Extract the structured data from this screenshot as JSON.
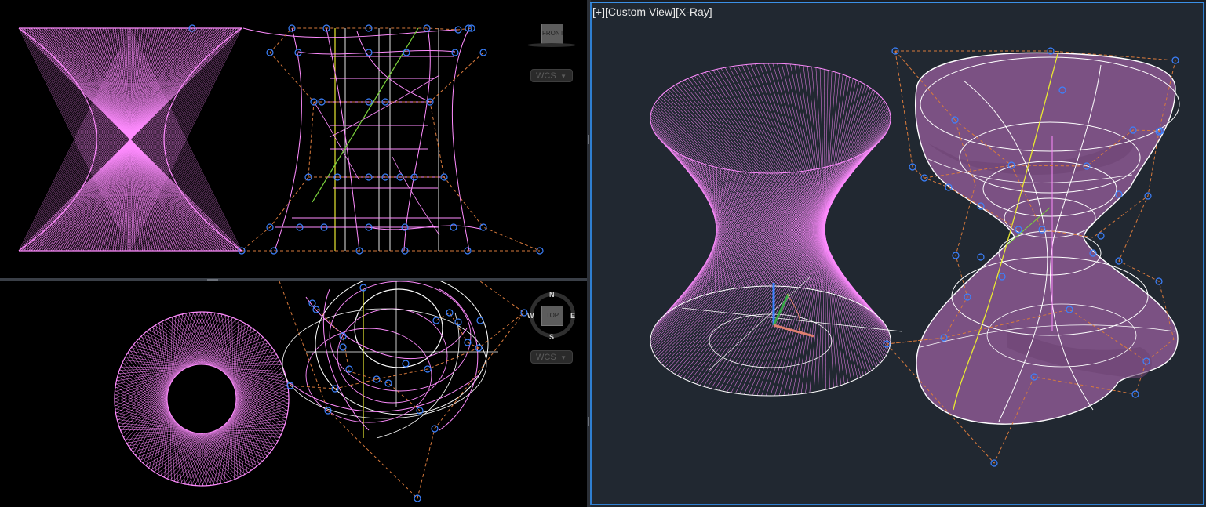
{
  "viewport_label": {
    "plus": "[+]",
    "view": "[Custom View]",
    "style": "[X-Ray]"
  },
  "front_viewport": {
    "viewcube_face": "FRONT",
    "wcs_label": "WCS"
  },
  "top_viewport": {
    "viewcube_face": "TOP",
    "wcs_label": "WCS",
    "compass": {
      "n": "N",
      "s": "S",
      "e": "E",
      "w": "W"
    }
  },
  "colors": {
    "surface_lines": "#ff8cff",
    "nurbs_surface": "#8f5a96",
    "isolines": "#ffffff",
    "control_vertex": "#3c82ff",
    "control_frame": "#d87a3c",
    "yellow_curve": "#e8e832",
    "green_curve": "#7ad23c",
    "active_border": "#2f7fd1",
    "bg_3d": "#212831"
  },
  "icons": {
    "viewcube": "viewcube-icon",
    "compass": "compass-icon",
    "ucs": "ucs-axis-icon",
    "control_vertex": "control-vertex-icon"
  }
}
